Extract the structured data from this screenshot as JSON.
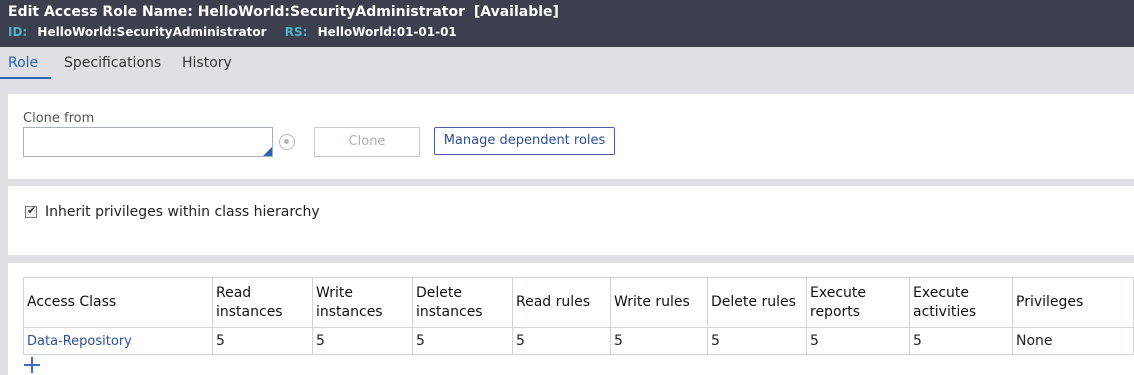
{
  "header": {
    "title": "Edit  Access Role Name: HelloWorld:SecurityAdministrator",
    "status": "[Available]",
    "id_label": "ID:",
    "id_value": "HelloWorld:SecurityAdministrator",
    "rs_label": "RS:",
    "rs_value": "HelloWorld:01-01-01"
  },
  "tabs": [
    {
      "label": "Role",
      "active": true
    },
    {
      "label": "Specifications",
      "active": false
    },
    {
      "label": "History",
      "active": false
    }
  ],
  "clone": {
    "label": "Clone from",
    "value": "",
    "clone_button": "Clone",
    "manage_button": "Manage dependent roles"
  },
  "inherit": {
    "checked": true,
    "label": "Inherit privileges within class hierarchy"
  },
  "table": {
    "headers": [
      "Access Class",
      "Read instances",
      "Write instances",
      "Delete instances",
      "Read rules",
      "Write rules",
      "Delete rules",
      "Execute reports",
      "Execute activities",
      "Privileges"
    ],
    "rows": [
      [
        "Data-Repository",
        "5",
        "5",
        "5",
        "5",
        "5",
        "5",
        "5",
        "5",
        "None"
      ]
    ]
  },
  "colors": {
    "header_bg": "#3c3f4d",
    "accent": "#2a64b8",
    "label_teal": "#4fb3c8"
  }
}
